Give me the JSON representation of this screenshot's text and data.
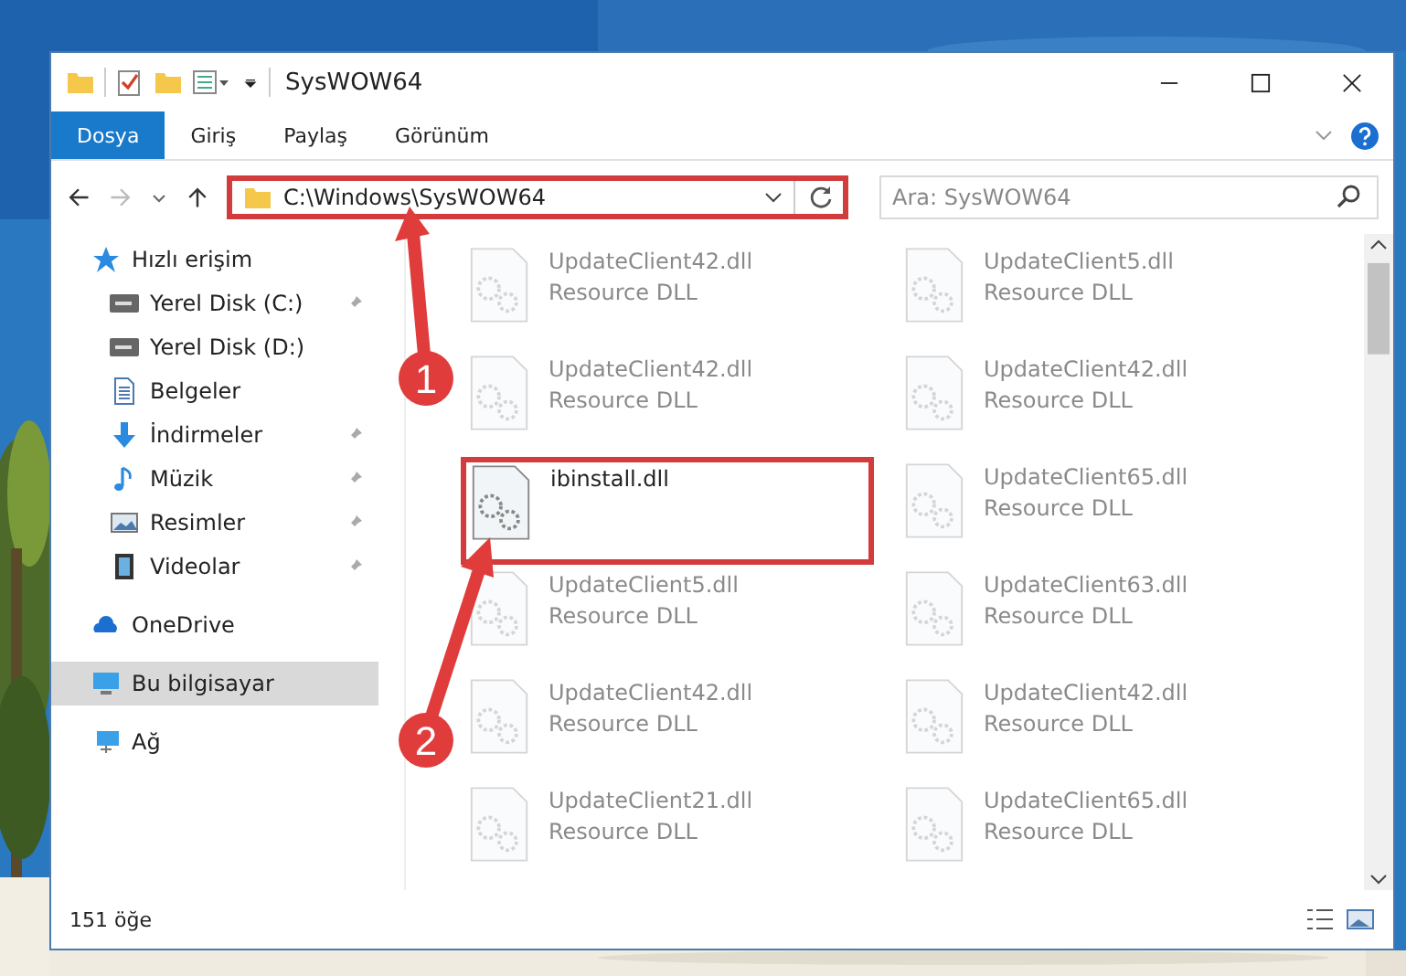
{
  "window": {
    "title": "SysWOW64"
  },
  "ribbon_tabs": [
    {
      "label": "Dosya",
      "selected": true
    },
    {
      "label": "Giriş",
      "selected": false
    },
    {
      "label": "Paylaş",
      "selected": false
    },
    {
      "label": "Görünüm",
      "selected": false
    }
  ],
  "address_bar": {
    "path": "C:\\Windows\\SysWOW64",
    "highlighted": true
  },
  "search": {
    "placeholder": "Ara: SysWOW64"
  },
  "sidebar": {
    "items": [
      {
        "label": "Hızlı erişim",
        "kind": "star",
        "selected": false,
        "children": [
          {
            "label": "Yerel Disk (C:)",
            "kind": "drive",
            "pinned": true,
            "selected": false
          },
          {
            "label": "Yerel Disk (D:)",
            "kind": "drive",
            "pinned": false,
            "selected": false
          },
          {
            "label": "Belgeler",
            "kind": "doc",
            "pinned": false,
            "selected": false
          },
          {
            "label": "İndirmeler",
            "kind": "download",
            "pinned": true,
            "selected": false
          },
          {
            "label": "Müzik",
            "kind": "music",
            "pinned": true,
            "selected": false
          },
          {
            "label": "Resimler",
            "kind": "pictures",
            "pinned": true,
            "selected": false
          },
          {
            "label": "Videolar",
            "kind": "video",
            "pinned": true,
            "selected": false
          }
        ]
      },
      {
        "label": "OneDrive",
        "kind": "cloud",
        "selected": false
      },
      {
        "label": "Bu bilgisayar",
        "kind": "pc",
        "selected": true
      },
      {
        "label": "Ağ",
        "kind": "network",
        "selected": false
      }
    ]
  },
  "files": [
    {
      "name": "UpdateClient42.dll",
      "type": "Resource DLL",
      "dimmed": true,
      "highlighted": false
    },
    {
      "name": "UpdateClient5.dll",
      "type": "Resource DLL",
      "dimmed": true,
      "highlighted": false
    },
    {
      "name": "UpdateClient42.dll",
      "type": "Resource DLL",
      "dimmed": true,
      "highlighted": false
    },
    {
      "name": "UpdateClient42.dll",
      "type": "Resource DLL",
      "dimmed": true,
      "highlighted": false
    },
    {
      "name": "ibinstall.dll",
      "dimmed": false,
      "highlighted": true
    },
    {
      "name": "UpdateClient65.dll",
      "type": "Resource DLL",
      "dimmed": true,
      "highlighted": false
    },
    {
      "name": "UpdateClient5.dll",
      "type": "Resource DLL",
      "dimmed": true,
      "highlighted": false
    },
    {
      "name": "UpdateClient63.dll",
      "type": "Resource DLL",
      "dimmed": true,
      "highlighted": false
    },
    {
      "name": "UpdateClient42.dll",
      "type": "Resource DLL",
      "dimmed": true,
      "highlighted": false
    },
    {
      "name": "UpdateClient42.dll",
      "type": "Resource DLL",
      "dimmed": true,
      "highlighted": false
    },
    {
      "name": "UpdateClient21.dll",
      "type": "Resource DLL",
      "dimmed": true,
      "highlighted": false
    },
    {
      "name": "UpdateClient65.dll",
      "type": "Resource DLL",
      "dimmed": true,
      "highlighted": false
    }
  ],
  "status_bar": {
    "count": "151 öğe"
  },
  "callouts": [
    {
      "number": "1"
    },
    {
      "number": "2"
    }
  ]
}
